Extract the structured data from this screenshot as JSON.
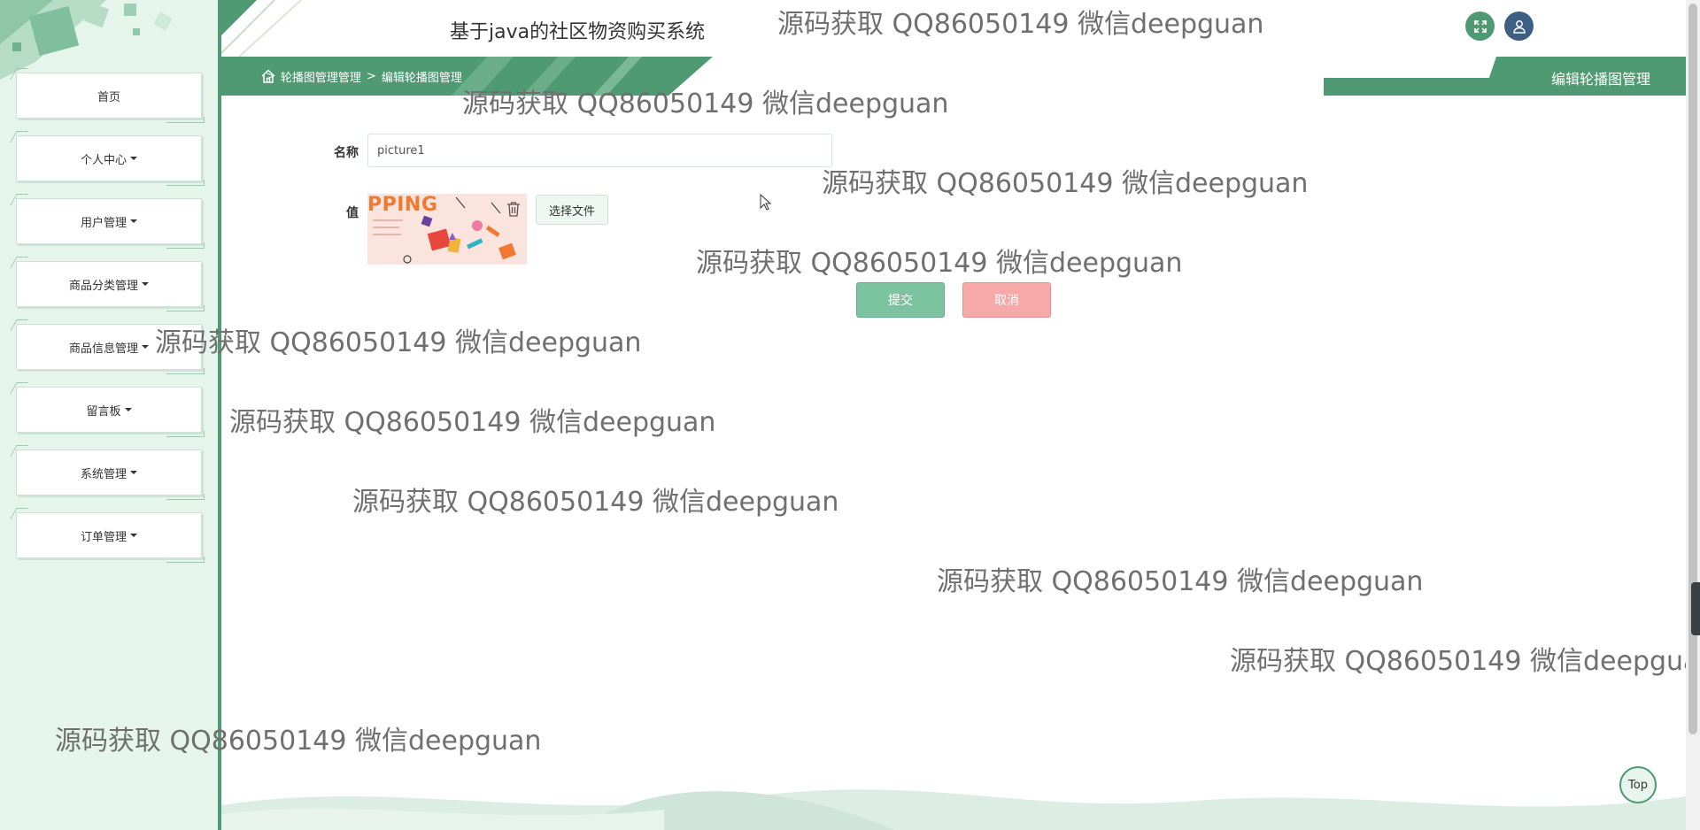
{
  "header": {
    "title": "基于java的社区物资购买系统",
    "fullscreen_icon": "expand-icon",
    "user_icon": "user-icon"
  },
  "sidebar": {
    "items": [
      {
        "label": "首页",
        "has_caret": false
      },
      {
        "label": "个人中心",
        "has_caret": true
      },
      {
        "label": "用户管理",
        "has_caret": true
      },
      {
        "label": "商品分类管理",
        "has_caret": true
      },
      {
        "label": "商品信息管理",
        "has_caret": true
      },
      {
        "label": "留言板",
        "has_caret": true
      },
      {
        "label": "系统管理",
        "has_caret": true
      },
      {
        "label": "订单管理",
        "has_caret": true
      }
    ]
  },
  "breadcrumb": {
    "home_icon": "home-icon",
    "separator": ">",
    "items": [
      "轮播图管理管理",
      "编辑轮播图管理"
    ],
    "page_heading": "编辑轮播图管理"
  },
  "form": {
    "name_label": "名称",
    "name_value": "picture1",
    "value_label": "值",
    "preview_text": "PPING",
    "delete_icon": "trash-icon",
    "choose_file_label": "选择文件",
    "submit_label": "提交",
    "cancel_label": "取消"
  },
  "watermark": {
    "text": "源码获取 QQ86050149 微信deepguan"
  },
  "back_to_top": {
    "label": "Top"
  },
  "colors": {
    "primary": "#4f9a72",
    "sidebar_bg": "#e6f5ec",
    "submit": "#7cc4a0",
    "cancel": "#f7a8a8",
    "user_avatar": "#3d5f82"
  }
}
